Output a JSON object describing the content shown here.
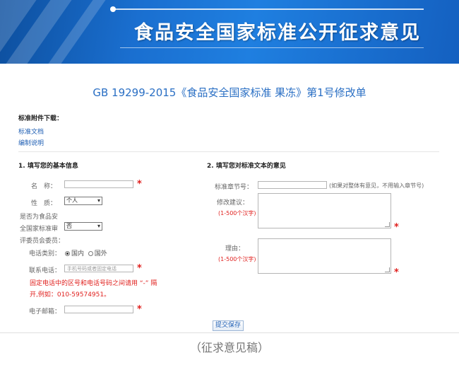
{
  "banner": {
    "title": "食品安全国家标准公开征求意见"
  },
  "document": {
    "title": "GB 19299-2015《食品安全国家标准 果冻》第1号修改单"
  },
  "attachments": {
    "heading": "标准附件下载：",
    "items": [
      "标准文档",
      "编制说明"
    ]
  },
  "section1": {
    "heading": "1. 填写您的基本信息",
    "name_label": "名　称：",
    "identity_label": "性　质：",
    "identity_value": "个人",
    "committee_label_1": "是否为食品安",
    "committee_label_2": "全国家标准审",
    "committee_label_3": "评委员会委员：",
    "committee_value": "否",
    "phone_type_label": "电话类别：",
    "phone_type_options": [
      "国内",
      "国外"
    ],
    "phone_label": "联系电话：",
    "phone_placeholder": "手机号码或者固定电话",
    "phone_note_1": "固定电话中的区号和电话号码之间请用 “-” 隔",
    "phone_note_2": "开,例如：010-59574951。",
    "email_label": "电子邮箱："
  },
  "section2": {
    "heading": "2. 填写您对标准文本的意见",
    "chapter_label": "标准章节号：",
    "chapter_hint": "(如果对整体有意见，不用输入章节号)",
    "suggestion_label": "修改建议：",
    "suggestion_limit": "(1-500个汉字)",
    "reason_label": "理由：",
    "reason_limit": "(1-500个汉字)"
  },
  "required_mark": "*",
  "submit_label": "提交保存",
  "caption": "（征求意见稿）",
  "colors": {
    "banner": "#1a6fd0",
    "title": "#2a6fc4",
    "required": "#e0201e",
    "link": "#1f5fb4"
  }
}
